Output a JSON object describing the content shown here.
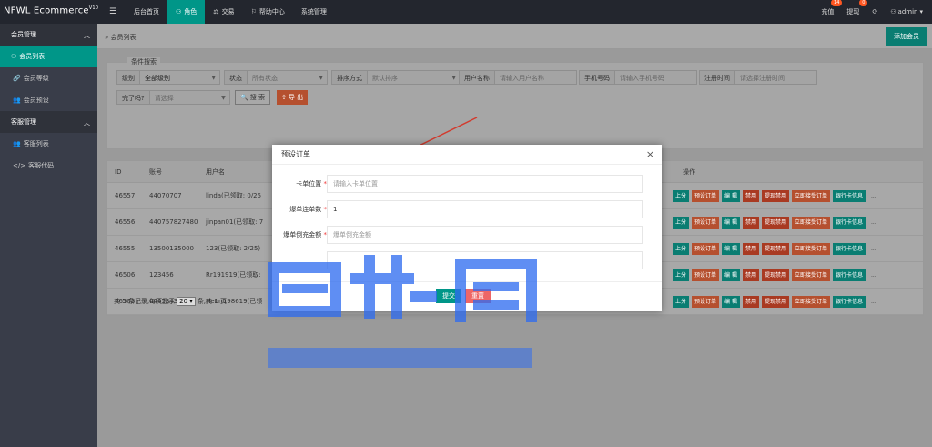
{
  "app": {
    "brand": "NFWL Ecommerce",
    "version": "V10"
  },
  "topnav": [
    {
      "label": "后台首页",
      "icon": ""
    },
    {
      "label": "角色",
      "icon": "user-icon"
    },
    {
      "label": "交易",
      "icon": "scale-icon"
    },
    {
      "label": "帮助中心",
      "icon": "flag-icon"
    },
    {
      "label": "系统管理",
      "icon": ""
    }
  ],
  "topright": {
    "recharge": "充值",
    "recharge_badge": "14",
    "withdraw": "提现",
    "withdraw_badge": "0",
    "user": "admin"
  },
  "sidebar": {
    "group1": "会员管理",
    "items1": [
      "会员列表",
      "会员等级",
      "会员预设"
    ],
    "group2": "客服管理",
    "items2": [
      "客服列表",
      "客服代码"
    ]
  },
  "breadcrumb": "会员列表",
  "add_button": "添加会员",
  "search": {
    "legend": "条件搜索",
    "level_label": "级别",
    "level_value": "全部级别",
    "status_label": "状态",
    "status_value": "所有状态",
    "sort_label": "排序方式",
    "sort_value": "默认排序",
    "username_label": "用户名称",
    "username_placeholder": "请输入用户名称",
    "phone_label": "手机号码",
    "phone_placeholder": "请输入手机号码",
    "regtime_label": "注册时间",
    "regtime_placeholder": "请选择注册时间",
    "complete_label": "完了吗?",
    "complete_value": "请选择",
    "search_btn": "搜 索",
    "export_btn": "导 出"
  },
  "table": {
    "headers": [
      "ID",
      "账号",
      "用户名",
      "操作"
    ],
    "rows": [
      {
        "id": "46557",
        "account": "44070707",
        "name": "linda(已领取: 0/25"
      },
      {
        "id": "46556",
        "account": "440757827480",
        "name": "jinpan01(已领取: 7"
      },
      {
        "id": "46555",
        "account": "13500135000",
        "name": "123(已领取: 2/25)"
      },
      {
        "id": "46506",
        "account": "123456",
        "name": "Rr191919(已领取:"
      },
      {
        "id": "46503",
        "account": "0445343566",
        "name": "Henri198619(已领"
      }
    ],
    "ops": [
      "上分",
      "预设订单",
      "编 辑",
      "禁用",
      "提现禁用",
      "立即接受订单",
      "银行卡信息",
      "..."
    ]
  },
  "pager": {
    "total": "共 5 条记录,每页显示",
    "size": "20",
    "suffix": "条,共 1 页"
  },
  "modal": {
    "title": "预设订单",
    "card_label": "卡单位置",
    "card_placeholder": "请输入卡单位置",
    "count_label": "爆单连单数",
    "count_value": "1",
    "amount_label": "爆单倒充金额",
    "amount_placeholder": "爆单倒充金额",
    "submit": "提交",
    "reset": "重置"
  },
  "colors": {
    "accent": "#009688",
    "danger": "#ff5722",
    "watermark": "#2f6cf0"
  }
}
